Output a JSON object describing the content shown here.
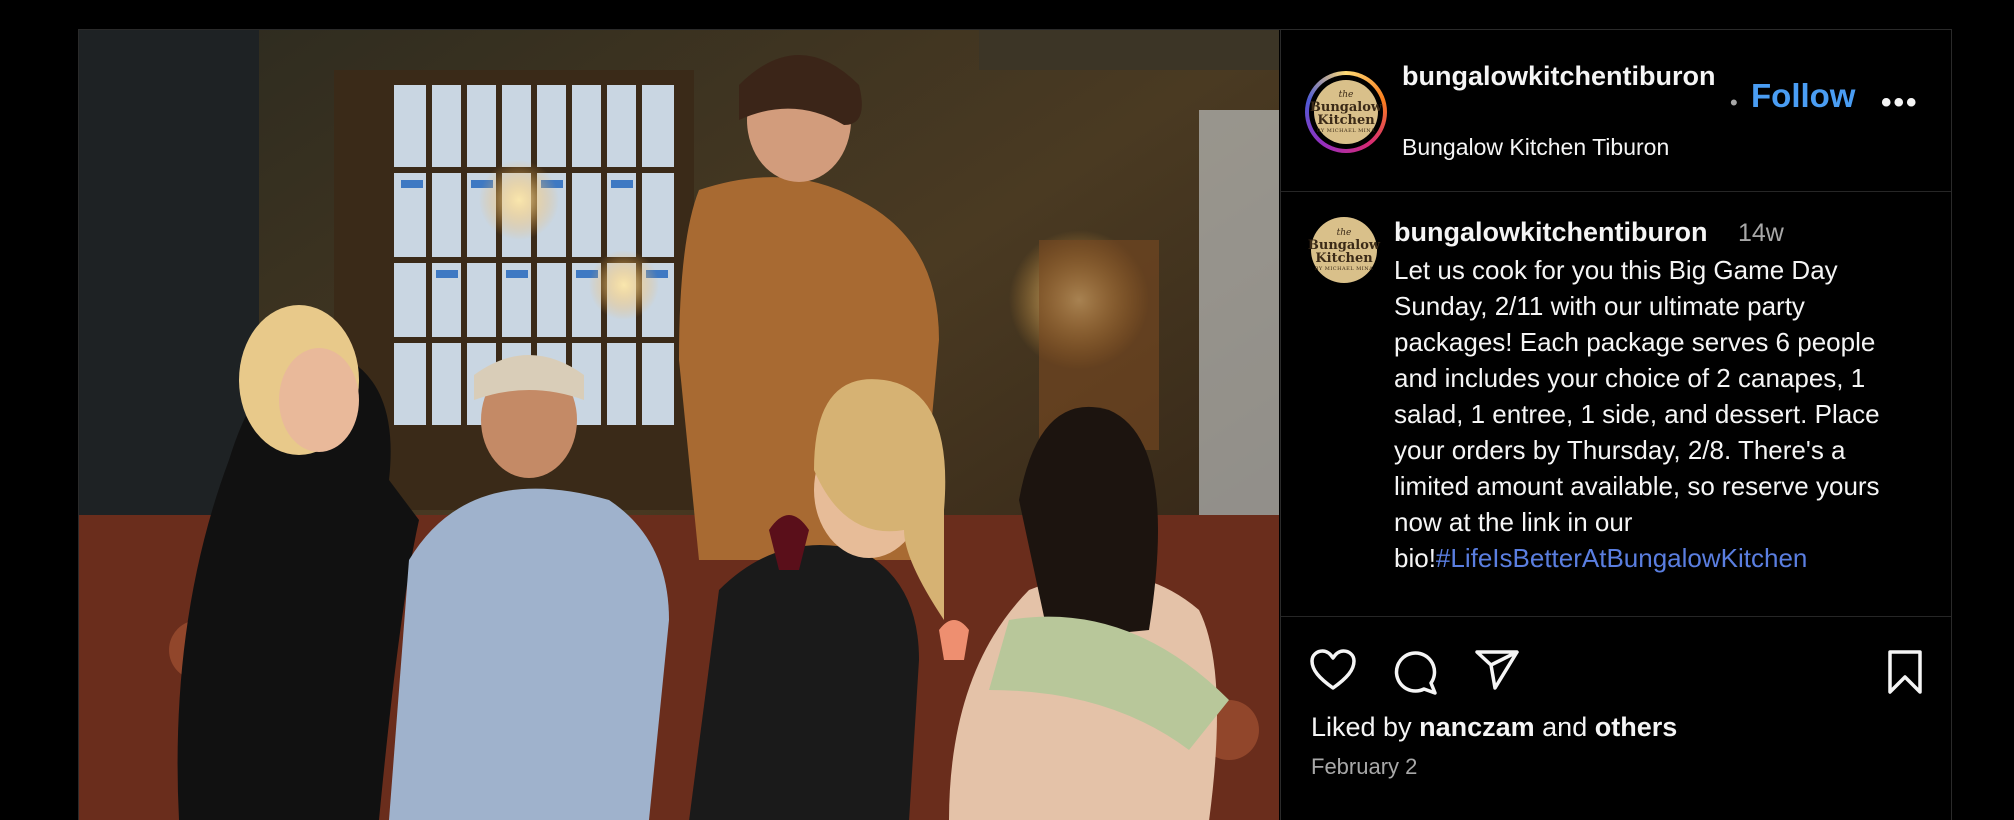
{
  "post": {
    "photo_alt": "",
    "header": {
      "username": "bungalowkitchentiburon",
      "location": "Bungalow Kitchen Tiburon",
      "separator": "•",
      "follow_label": "Follow",
      "more_label": "•••"
    },
    "logo": {
      "line1": "the",
      "line2": "Bungalow",
      "line3": "Kitchen",
      "line4": "BY MICHAEL MINA"
    },
    "caption": {
      "username": "bungalowkitchentiburon",
      "time": "14w",
      "text": "Let us cook for you this Big Game Day Sunday, 2/11 with our ultimate party packages! Each package serves 6 people and includes your choice of 2 canapes, 1 salad, 1 entree, 1 side, and dessert. Place your orders by Thursday, 2/8. There's a limited amount available, so reserve yours now at the link in our bio!",
      "hashtag": "#LifeIsBetterAtBungalowKitchen"
    },
    "actions": {
      "like_icon": "heart-icon",
      "comment_icon": "comment-icon",
      "share_icon": "share-icon",
      "save_icon": "bookmark-icon"
    },
    "likes": {
      "prefix": "Liked by",
      "user": "nanczam",
      "joiner": "and",
      "others": "others"
    },
    "date": "February 2"
  },
  "colors": {
    "follow": "#4a9df3",
    "hashtag": "#5a7ee0",
    "muted": "#a8a8a8",
    "background": "#000000"
  }
}
